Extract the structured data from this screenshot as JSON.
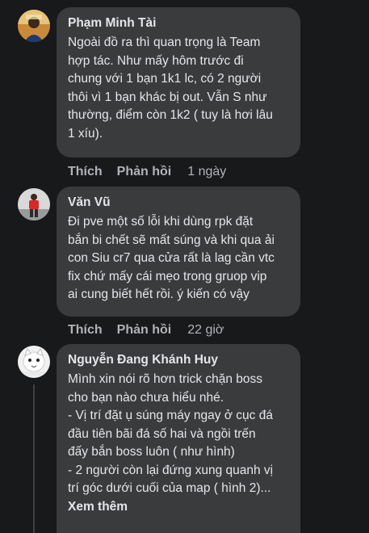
{
  "comments": [
    {
      "author": "Phạm Minh Tài",
      "lines": [
        "Ngoài đồ ra thì quan trọng là Team",
        "hợp tác. Như mấy hôm trước đi",
        "chung với 1 bạn 1k1 lc, có 2 người",
        "thôi vì 1 bạn khác bị out. Vẫn S như",
        "thường, điểm còn 1k2 ( tuy là hơi lâu",
        "1 xíu)."
      ],
      "like_label": "Thích",
      "reply_label": "Phản hồi",
      "time": "1 ngày"
    },
    {
      "author": "Văn Vũ",
      "lines": [
        "Đi pve một số lỗi khi dùng rpk đặt",
        "bắn bi chết sẽ mất súng và khi qua ải",
        "con Siu cr7 qua cửa rất là lag cần vtc",
        "fix chứ mấy cái mẹo trong gruop vip",
        "ai cung biết hết rồi. ý kiến có vậy"
      ],
      "like_label": "Thích",
      "reply_label": "Phản hồi",
      "time": "22 giờ"
    },
    {
      "author": "Nguyễn Đang Khánh Huy",
      "lines": [
        "Mình xin nói rõ hơn trick chặn boss",
        "cho bạn nào chưa hiểu nhé.",
        "- Vị trí đặt ụ súng máy ngay ở cục đá",
        "đầu tiên bãi đá số hai và ngồi trến",
        "đấy bắn boss luôn ( như hình)",
        "- 2 người còn lại đứng xung quanh vị",
        "trí góc dưới cuối của map ( hình 2)..."
      ],
      "see_more": "Xem thêm"
    }
  ],
  "colors": {
    "background": "#18191a",
    "bubble": "#3a3b3c",
    "text": "#e4e6eb",
    "secondary_text": "#b0b3b8"
  }
}
